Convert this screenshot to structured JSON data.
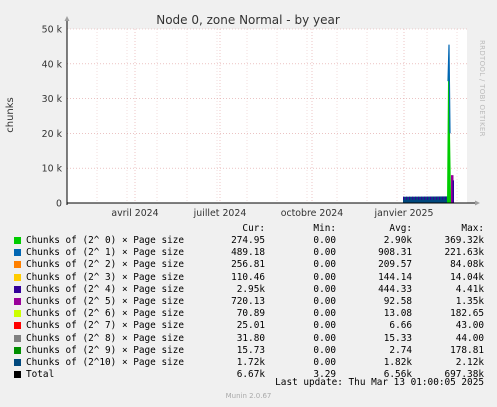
{
  "chart_data": {
    "type": "area",
    "title": "Node 0, zone Normal - by year",
    "ylabel": "chunks",
    "ylim": [
      0,
      50000
    ],
    "y_ticks": [
      {
        "value": 0,
        "label": "0"
      },
      {
        "value": 10000,
        "label": "10 k"
      },
      {
        "value": 20000,
        "label": "20 k"
      },
      {
        "value": 30000,
        "label": "30 k"
      },
      {
        "value": 40000,
        "label": "40 k"
      },
      {
        "value": 50000,
        "label": "50 k"
      }
    ],
    "x_range_days": [
      0,
      400
    ],
    "x_ticks": [
      {
        "day": 68,
        "label": "avril 2024"
      },
      {
        "day": 153,
        "label": "juillet 2024"
      },
      {
        "day": 245,
        "label": "octobre 2024"
      },
      {
        "day": 337,
        "label": "janvier 2025"
      }
    ],
    "grid": true,
    "series_stack_estimate": [
      {
        "name": "Chunks of (2^10) × Page size",
        "points": [
          [
            336,
            1800
          ],
          [
            382,
            1900
          ],
          [
            384,
            2100
          ]
        ]
      },
      {
        "name": "Chunks of (2^ 0) × Page size",
        "points": [
          [
            380,
            0
          ],
          [
            381,
            35000
          ],
          [
            382,
            45500
          ],
          [
            383,
            20000
          ],
          [
            384,
            2000
          ]
        ]
      }
    ],
    "legend": [
      {
        "label": "Chunks of (2^ 0) × Page size",
        "color": "#00cc00",
        "cur": "274.95",
        "min": "0.00",
        "avg": "2.90k",
        "max": "369.32k"
      },
      {
        "label": "Chunks of (2^ 1) × Page size",
        "color": "#0066b3",
        "cur": "489.18",
        "min": "0.00",
        "avg": "908.31",
        "max": "221.63k"
      },
      {
        "label": "Chunks of (2^ 2) × Page size",
        "color": "#ff8000",
        "cur": "256.81",
        "min": "0.00",
        "avg": "209.57",
        "max": "84.08k"
      },
      {
        "label": "Chunks of (2^ 3) × Page size",
        "color": "#ffcc00",
        "cur": "110.46",
        "min": "0.00",
        "avg": "144.14",
        "max": "14.04k"
      },
      {
        "label": "Chunks of (2^ 4) × Page size",
        "color": "#330099",
        "cur": "2.95k",
        "min": "0.00",
        "avg": "444.33",
        "max": "4.41k"
      },
      {
        "label": "Chunks of (2^ 5) × Page size",
        "color": "#990099",
        "cur": "720.13",
        "min": "0.00",
        "avg": "92.58",
        "max": "1.35k"
      },
      {
        "label": "Chunks of (2^ 6) × Page size",
        "color": "#ccff00",
        "cur": "70.89",
        "min": "0.00",
        "avg": "13.08",
        "max": "182.65"
      },
      {
        "label": "Chunks of (2^ 7) × Page size",
        "color": "#ff0000",
        "cur": "25.01",
        "min": "0.00",
        "avg": "6.66",
        "max": "43.00"
      },
      {
        "label": "Chunks of (2^ 8) × Page size",
        "color": "#808080",
        "cur": "31.80",
        "min": "0.00",
        "avg": "15.33",
        "max": "44.00"
      },
      {
        "label": "Chunks of (2^ 9) × Page size",
        "color": "#008f00",
        "cur": "15.73",
        "min": "0.00",
        "avg": "2.74",
        "max": "178.81"
      },
      {
        "label": "Chunks of (2^10) × Page size",
        "color": "#00487d",
        "cur": "1.72k",
        "min": "0.00",
        "avg": "1.82k",
        "max": "2.12k"
      },
      {
        "label": "Total",
        "color": "#000000",
        "cur": "6.67k",
        "min": "3.29",
        "avg": "6.56k",
        "max": "697.38k"
      }
    ]
  },
  "headers": {
    "cur": "Cur:",
    "min": "Min:",
    "avg": "Avg:",
    "max": "Max:"
  },
  "last_update": "Last update: Thu Mar 13 01:00:05 2025",
  "munin_version": "Munin 2.0.67",
  "side_label": "RRDTOOL / TOBI OETIKER"
}
